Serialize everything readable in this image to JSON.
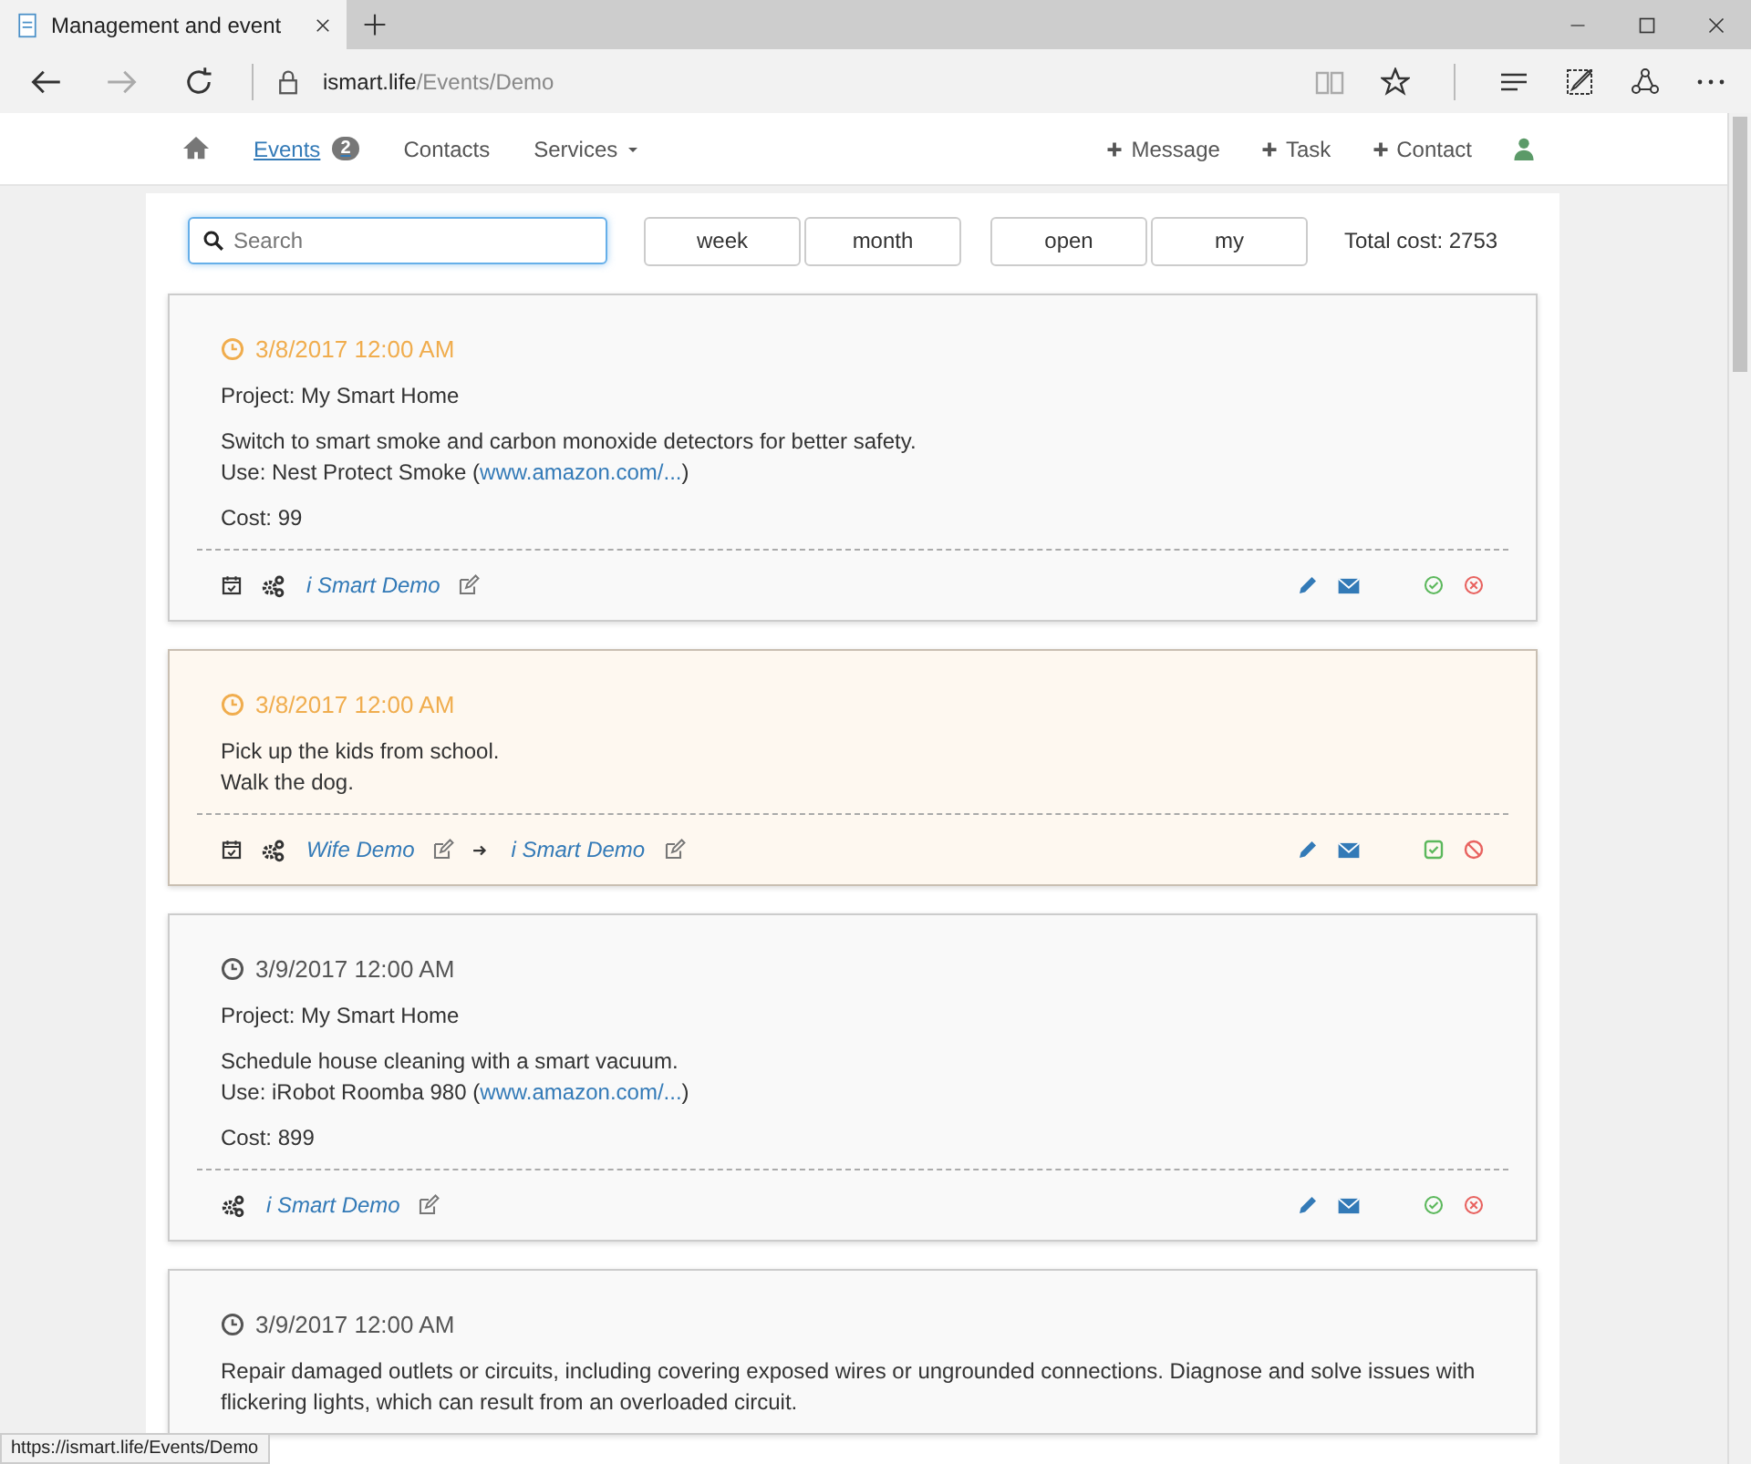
{
  "browser": {
    "tab_title": "Management and event",
    "address_host": "ismart.life",
    "address_path": "/Events/Demo",
    "status_url": "https://ismart.life/Events/Demo"
  },
  "nav": {
    "left": [
      {
        "label": "Events",
        "badge": "2",
        "selected": true,
        "kind": "link"
      },
      {
        "label": "Contacts",
        "selected": false,
        "kind": "link"
      },
      {
        "label": "Services",
        "selected": false,
        "kind": "dropdown"
      }
    ],
    "right": [
      {
        "label": "Message",
        "kind": "plus"
      },
      {
        "label": "Task",
        "kind": "plus"
      },
      {
        "label": "Contact",
        "kind": "plus"
      }
    ]
  },
  "toolbar": {
    "search_placeholder": "Search",
    "period_buttons": [
      "week",
      "month"
    ],
    "filter_buttons": [
      "open",
      "my"
    ],
    "total_cost": "Total cost: 2753"
  },
  "events": [
    {
      "date": "3/8/2017 12:00 AM",
      "overdue": true,
      "highlighted": false,
      "project": "Project: My Smart Home",
      "lines": [
        "Switch to smart smoke and carbon monoxide detectors for better safety."
      ],
      "use": {
        "prefix": "Use: Nest Protect Smoke (",
        "link": "www.amazon.com/...",
        "suffix": ")"
      },
      "cost": "Cost: 99",
      "calendar": true,
      "people": [
        "i Smart Demo"
      ],
      "confirmed": false
    },
    {
      "date": "3/8/2017 12:00 AM",
      "overdue": true,
      "highlighted": true,
      "lines": [
        "Pick up the kids from school.",
        "Walk the dog."
      ],
      "calendar": true,
      "people": [
        "Wife Demo",
        "i Smart Demo"
      ],
      "confirmed": true
    },
    {
      "date": "3/9/2017 12:00 AM",
      "overdue": false,
      "highlighted": false,
      "project": "Project: My Smart Home",
      "lines": [
        "Schedule house cleaning with a smart vacuum."
      ],
      "use": {
        "prefix": "Use: iRobot Roomba 980 (",
        "link": "www.amazon.com/...",
        "suffix": ")"
      },
      "cost": "Cost: 899",
      "calendar": false,
      "people": [
        "i Smart Demo"
      ],
      "confirmed": false
    },
    {
      "date": "3/9/2017 12:00 AM",
      "overdue": false,
      "highlighted": false,
      "lines": [
        "Repair damaged outlets or circuits, including covering exposed wires or ungrounded connections. Diagnose and solve issues with flickering lights, which can result from an overloaded circuit."
      ]
    }
  ]
}
